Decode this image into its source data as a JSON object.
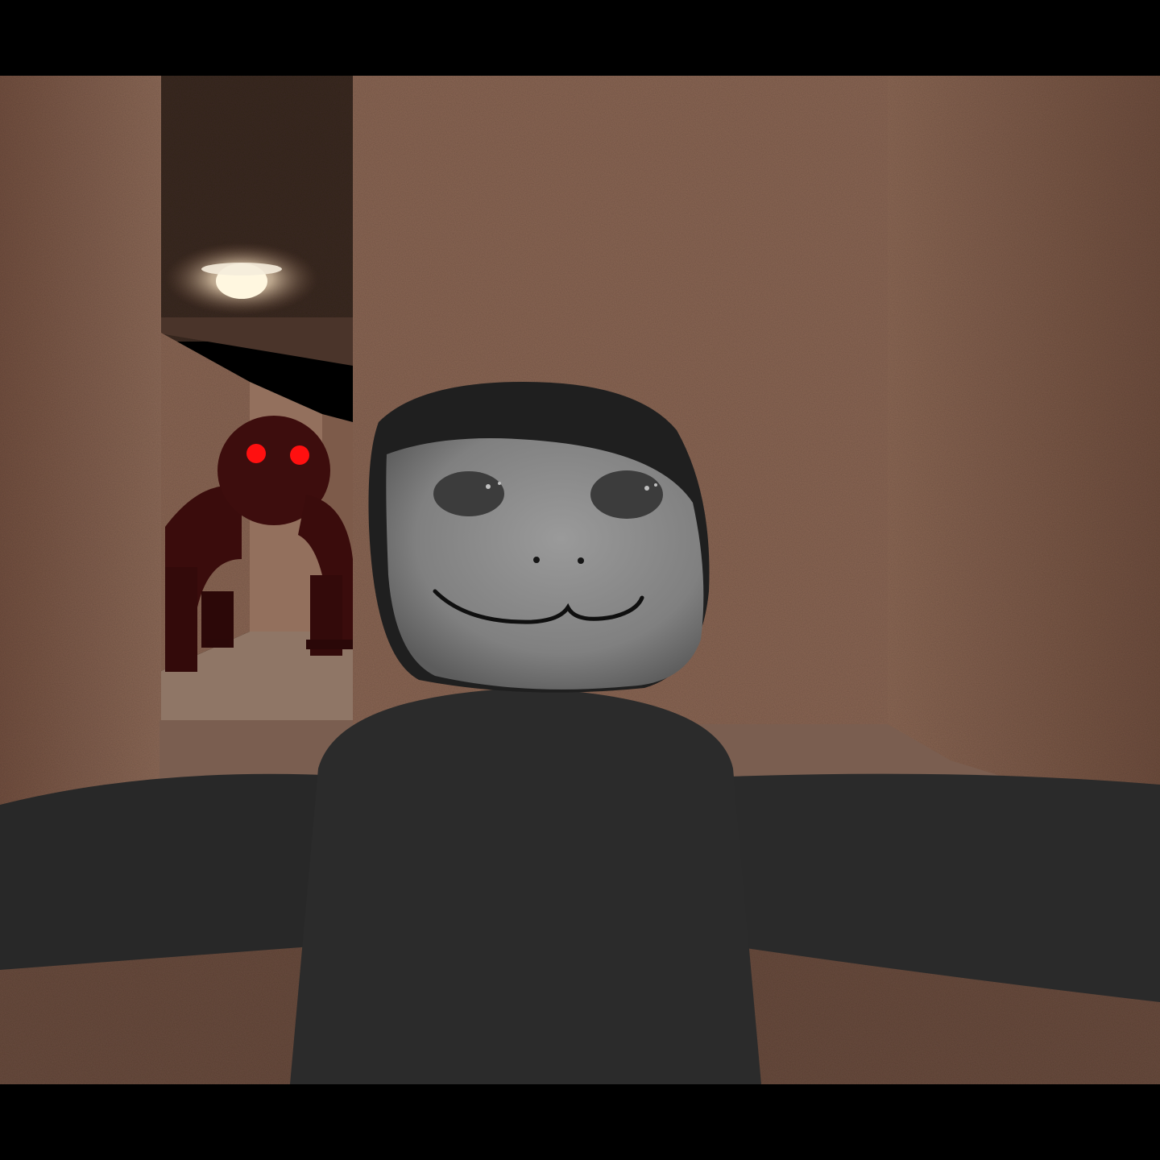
{
  "scene": {
    "letterbox_color": "#000000",
    "wall_color": "#8a6552",
    "wall_dark_color": "#6e4c3c",
    "floor_color": "#7a5e50",
    "ceiling_color": "#3f2c24",
    "light_color": "#fff4dc"
  },
  "player": {
    "body_color": "#2a2a2a",
    "face_color": "#8c8c8c",
    "expression": "smile"
  },
  "monster": {
    "body_color": "#3a0c0c",
    "eye_color": "#ff1010",
    "pose": "crouching"
  }
}
